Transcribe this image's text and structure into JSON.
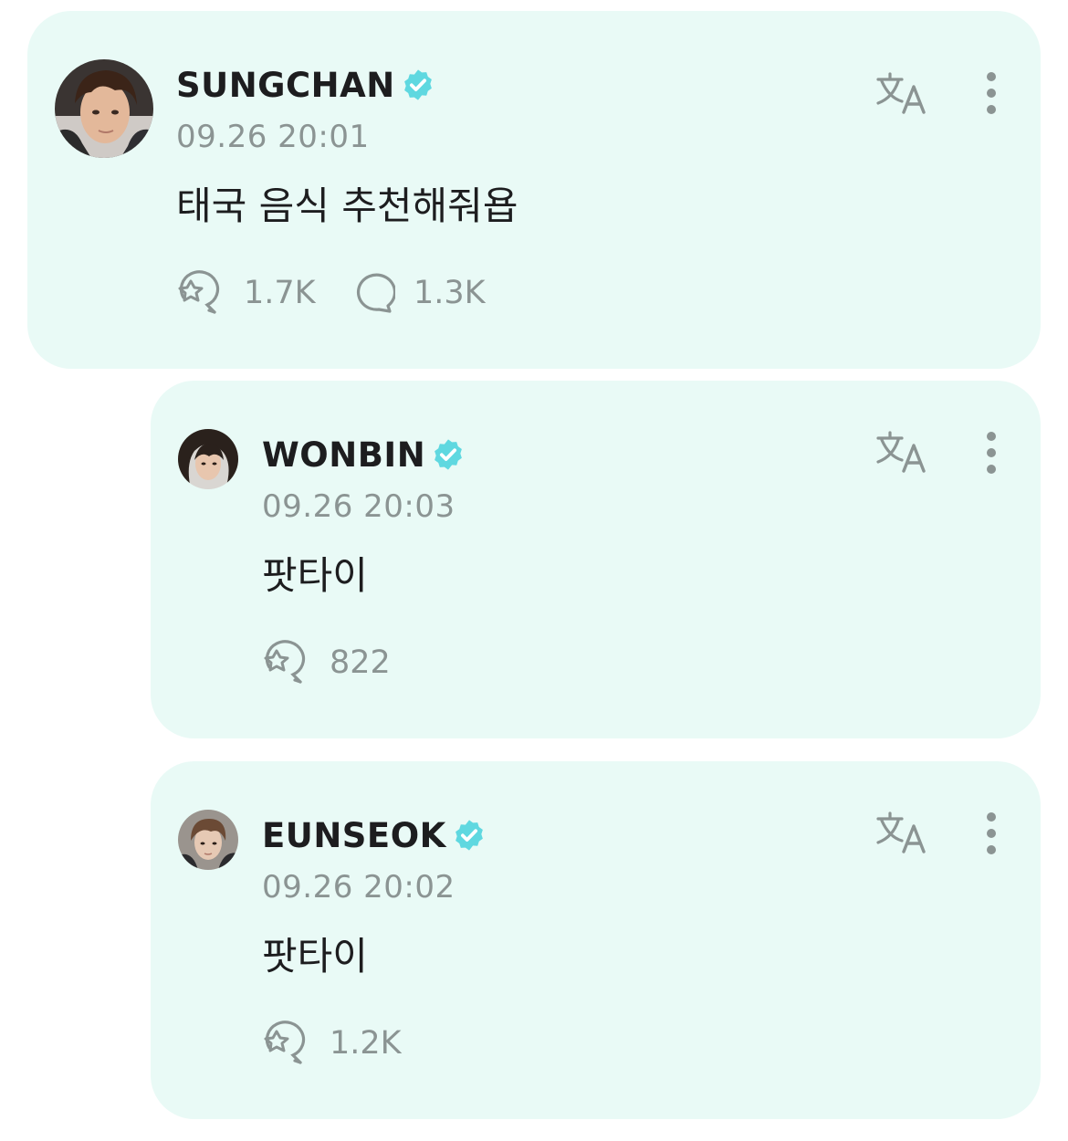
{
  "posts": [
    {
      "author": "SUNGCHAN",
      "timestamp": "09.26 20:01",
      "text": "태국 음식 추천해줘욥",
      "likes": "1.7K",
      "comments": "1.3K",
      "verified": true
    },
    {
      "author": "WONBIN",
      "timestamp": "09.26 20:03",
      "text": "팟타이",
      "likes": "822",
      "verified": true
    },
    {
      "author": "EUNSEOK",
      "timestamp": "09.26 20:02",
      "text": "팟타이",
      "likes": "1.2K",
      "verified": true
    }
  ],
  "icons": {
    "like": "star-bubble-icon",
    "comment": "speech-bubble-icon",
    "translate": "translate-icon",
    "more": "more-vertical-icon",
    "verified": "verified-badge-icon"
  },
  "colors": {
    "card_background": "#e9faf6",
    "verified_badge": "#5fd8e0",
    "muted_text": "#8b9493",
    "primary_text": "#1d1d1f"
  }
}
